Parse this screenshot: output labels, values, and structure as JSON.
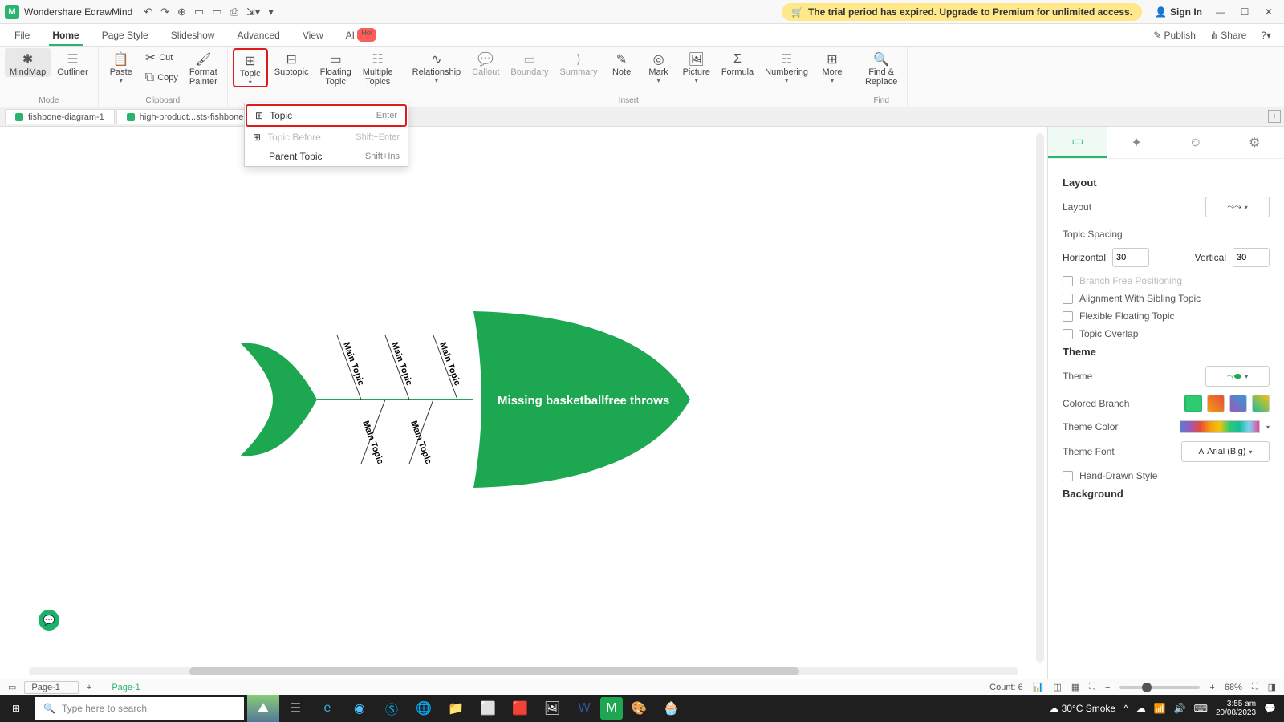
{
  "app": {
    "title": "Wondershare EdrawMind",
    "icon_letter": "M"
  },
  "trial_banner": "The trial period has expired. Upgrade to Premium for unlimited access.",
  "signin": "Sign In",
  "menu_tabs": [
    "File",
    "Home",
    "Page Style",
    "Slideshow",
    "Advanced",
    "View",
    "AI"
  ],
  "publish": "Publish",
  "share": "Share",
  "ribbon": {
    "mode": {
      "mindmap": "MindMap",
      "outliner": "Outliner",
      "label": "Mode"
    },
    "clipboard": {
      "paste": "Paste",
      "cut": "Cut",
      "copy": "Copy",
      "fmtpainter": "Format\nPainter",
      "label": "Clipboard"
    },
    "topic": {
      "topic": "Topic",
      "subtopic": "Subtopic",
      "floating": "Floating\nTopic",
      "multiple": "Multiple\nTopics"
    },
    "insert": {
      "relationship": "Relationship",
      "callout": "Callout",
      "boundary": "Boundary",
      "summary": "Summary",
      "note": "Note",
      "mark": "Mark",
      "picture": "Picture",
      "formula": "Formula",
      "numbering": "Numbering",
      "more": "More",
      "label": "Insert"
    },
    "find": {
      "label": "Find &\nReplace",
      "group": "Find"
    }
  },
  "topic_dropdown": [
    {
      "label": "Topic",
      "shortcut": "Enter",
      "icon": "⊞",
      "highlight": true,
      "disabled": false
    },
    {
      "label": "Topic Before",
      "shortcut": "Shift+Enter",
      "icon": "⊞",
      "highlight": false,
      "disabled": true
    },
    {
      "label": "Parent Topic",
      "shortcut": "Shift+Ins",
      "icon": "",
      "highlight": false,
      "disabled": false
    }
  ],
  "doc_tabs": [
    "fishbone-diagram-1",
    "high-product...sts-fishbone"
  ],
  "diagram": {
    "head_text": "Missing basketballfree throws",
    "bones": [
      "Main Topic",
      "Main Topic",
      "Main Topic",
      "Main Topic",
      "Main Topic"
    ]
  },
  "right_panel": {
    "layout_section": "Layout",
    "layout_label": "Layout",
    "spacing_label": "Topic Spacing",
    "horizontal": "Horizontal",
    "horizontal_val": "30",
    "vertical": "Vertical",
    "vertical_val": "30",
    "branch_free": "Branch Free Positioning",
    "align_sibling": "Alignment With Sibling Topic",
    "flexible_floating": "Flexible Floating Topic",
    "topic_overlap": "Topic Overlap",
    "theme_section": "Theme",
    "theme_label": "Theme",
    "colored_branch": "Colored Branch",
    "theme_color": "Theme Color",
    "theme_font": "Theme Font",
    "theme_font_val": "Arial (Big)",
    "hand_drawn": "Hand-Drawn Style",
    "background_section": "Background"
  },
  "status": {
    "page_sel": "Page-1",
    "page_active": "Page-1",
    "count": "Count: 6",
    "zoom": "68%"
  },
  "taskbar": {
    "search_placeholder": "Type here to search",
    "weather": "30°C  Smoke",
    "time": "3:55 am",
    "date": "20/08/2023"
  }
}
